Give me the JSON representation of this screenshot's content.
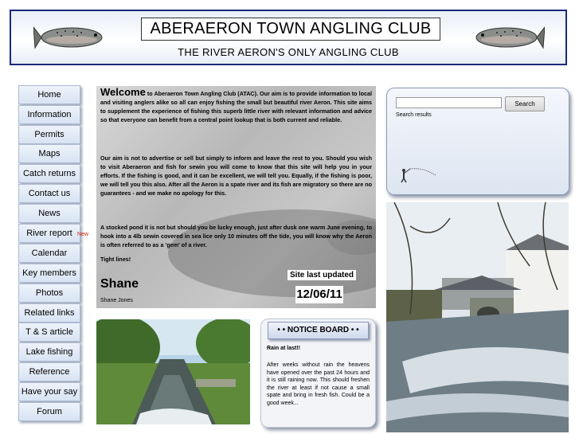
{
  "header": {
    "title": "ABERAERON TOWN ANGLING CLUB",
    "subtitle": "THE RIVER AERON'S ONLY ANGLING CLUB"
  },
  "nav": {
    "items": [
      "Home",
      "Information",
      "Permits",
      "Maps",
      "Catch returns",
      "Contact us",
      "News",
      "River report",
      "Calendar",
      "Key members",
      "Photos",
      "Related links",
      "T & S article",
      "Lake fishing",
      "Reference",
      "Have your say",
      "Forum"
    ],
    "new_badge": "New"
  },
  "welcome": {
    "heading": "Welcome",
    "p1": "to Aberaeron Town Angling Club (ATAC). Our aim is to provide information to local and visiting anglers alike so all can enjoy fishing the small but beautiful river Aeron. This site aims to supplement the experience of fishing this superb little river with relevant information and advice so that everyone can benefit from a central point lookup that is both current and reliable.",
    "p2": "Our aim is not to advertise or sell but simply to inform and leave the rest to you. Should you wish to visit Aberaeron and fish for sewin you will come to know that this site will help you in your efforts. If the fishing is good, and it can be excellent, we will tell you. Equally, if the fishing is poor, we will tell you this also. After all the Aeron is a spate river and its fish are migratory so there are no guarantees - and we make no apology for this.",
    "p3": "A stocked pond it is not but should you be lucky enough, just after dusk one warm June evening, to hook into a 4lb sewin covered in sea lice only 10 minutes off the tide, you will know why the Aeron is often referred to as a 'gem' of a river.",
    "p4": "Tight lines!",
    "signature": "Shane",
    "signature_full": "Shane Jones",
    "updated_label": "Site last updated",
    "updated_date": "12/06/11"
  },
  "search": {
    "button_label": "Search",
    "results_label": "Search results"
  },
  "notice": {
    "heading": "• • NOTICE BOARD • •",
    "title": "Rain at last!!",
    "body": "After weeks without rain the heavens have opened over the past 24 hours and it is still raining now. This should freshen the river at least if not cause a small spate and bring in fresh fish. Could be a good week..."
  }
}
